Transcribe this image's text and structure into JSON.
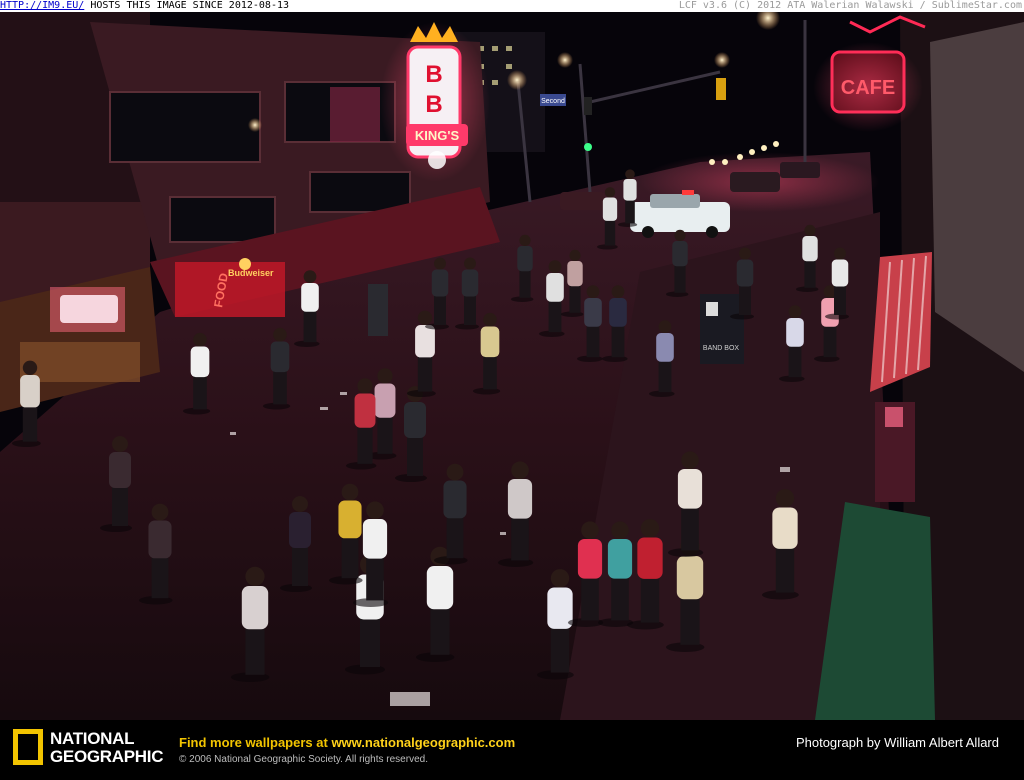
{
  "watermark": {
    "link_text": "HTTP://IM9.EU/",
    "host_text": "HOSTS THIS IMAGE SINCE 2012-08-13",
    "right_text": "LCF v3.6 (C) 2012 ATA Walerian Walawski / SublimeStar.com"
  },
  "photo": {
    "signs": {
      "bb_letter_1": "B",
      "bb_letter_2": "B",
      "bb_kings": "KING'S",
      "budweiser": "Budweiser",
      "food": "FOOD",
      "cafe": "CAFE",
      "street": "Second",
      "band_box": "BAND BOX"
    }
  },
  "footer": {
    "logo_line1": "NATIONAL",
    "logo_line2": "GEOGRAPHIC",
    "promo_prefix": "Find more wallpapers at ",
    "promo_url": "www.nationalgeographic.com",
    "copyright": "© 2006 National Geographic Society. All rights reserved.",
    "credit": "Photograph by William Albert Allard"
  },
  "colors": {
    "logo_yellow": "#f2c400",
    "neon_red": "#ff2a55"
  }
}
